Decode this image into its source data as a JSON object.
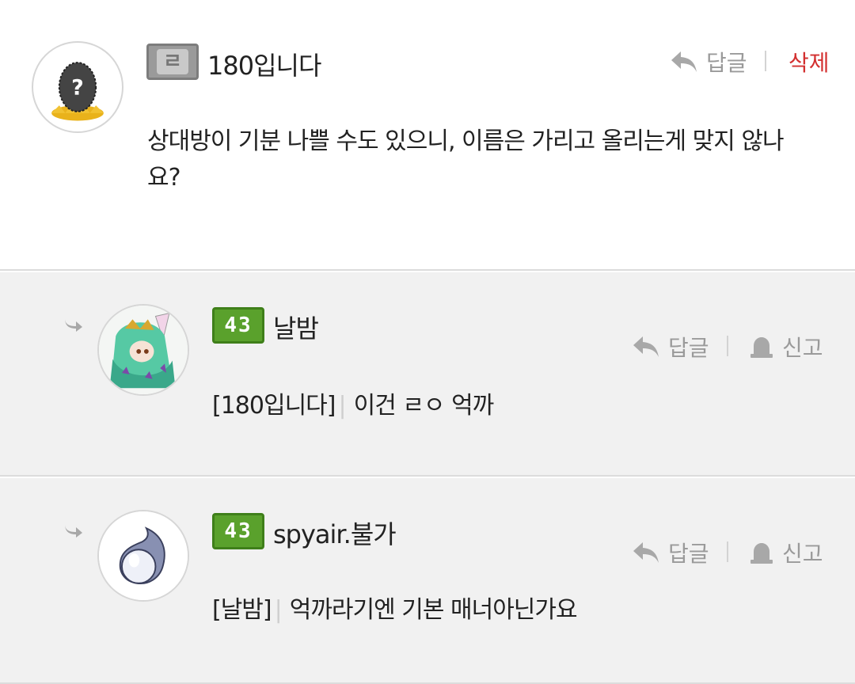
{
  "comments": [
    {
      "level": "ㄹ",
      "nickname": "180입니다",
      "text_line1": "상대방이 기분 나쁠 수도 있으니, 이름은 가리고 올리는게 맞지 않나",
      "text_line2": "요?",
      "reply_label": "답글",
      "delete_label": "삭제"
    },
    {
      "level": "43",
      "nickname": "날밤",
      "quote": "[180입니다]",
      "text": "이건 ㄹㅇ 억까",
      "reply_label": "답글",
      "report_label": "신고"
    },
    {
      "level": "43",
      "nickname": "spyair.불가",
      "quote": "[날밤]",
      "text": "억까라기엔 기본 매너아닌가요",
      "reply_label": "답글",
      "report_label": "신고"
    }
  ],
  "colors": {
    "delete": "#d32f2f",
    "level_green": "#5aa12c",
    "reply_bg": "#f1f1f1"
  }
}
